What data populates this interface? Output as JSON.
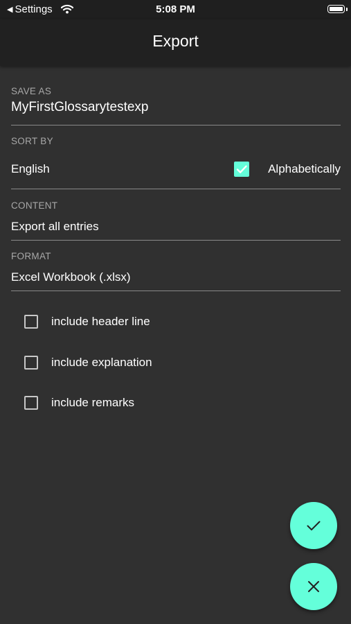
{
  "status_bar": {
    "back_label": "Settings",
    "back_arrow": "◀",
    "time": "5:08 PM",
    "icons": [
      "wifi-icon",
      "battery-icon"
    ]
  },
  "app_bar": {
    "title": "Export"
  },
  "save_as": {
    "label": "SAVE AS",
    "value": "MyFirstGlossarytestexp"
  },
  "sort_by": {
    "label": "SORT BY",
    "value": "English",
    "alphabetically_label": "Alphabetically",
    "alphabetically_checked": true
  },
  "content": {
    "label": "CONTENT",
    "value": "Export all entries"
  },
  "format": {
    "label": "FORMAT",
    "value": "Excel Workbook (.xlsx)"
  },
  "options": [
    {
      "label": "include header line",
      "checked": false
    },
    {
      "label": "include explanation",
      "checked": false
    },
    {
      "label": "include remarks",
      "checked": false
    }
  ],
  "actions": {
    "confirm_icon": "check-icon",
    "cancel_icon": "close-icon"
  },
  "colors": {
    "accent": "#64ffda",
    "background": "#303030",
    "app_bar": "#212121",
    "label": "#a8a8a8"
  }
}
